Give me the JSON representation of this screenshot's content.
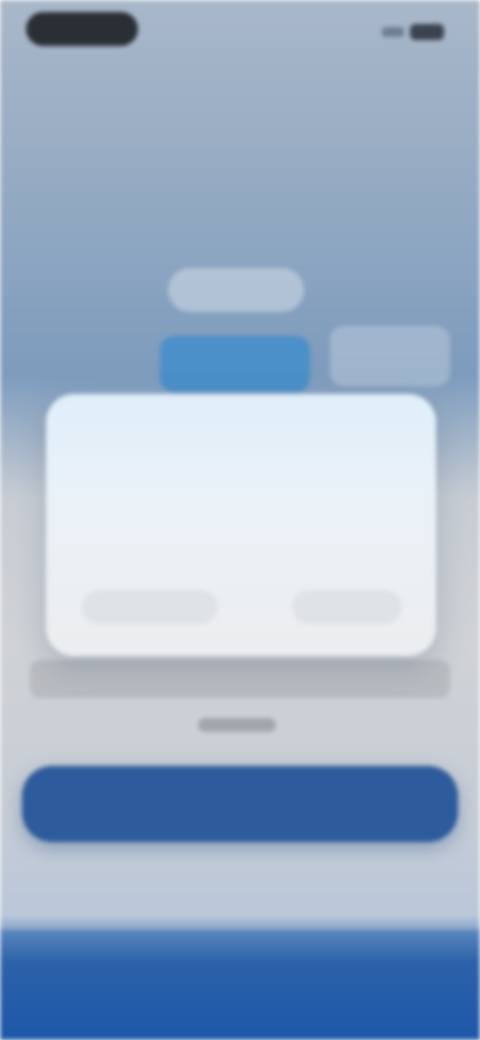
{
  "status_bar": {
    "time": "",
    "icons": [
      "signal-icon",
      "battery-icon"
    ]
  },
  "background": {
    "chip_label": "",
    "tabs": [
      {
        "label": "",
        "active": true
      },
      {
        "label": "",
        "active": false
      }
    ],
    "field_placeholder": "",
    "small_link": "",
    "primary_button_label": "",
    "secondary_link_label": ""
  },
  "dialog": {
    "title": "",
    "message": "",
    "secondary_action": "",
    "primary_action": ""
  },
  "colors": {
    "accent": "#2e5b9c",
    "active_tab": "#4b90c8",
    "bottom_band": "#1c57a8"
  }
}
